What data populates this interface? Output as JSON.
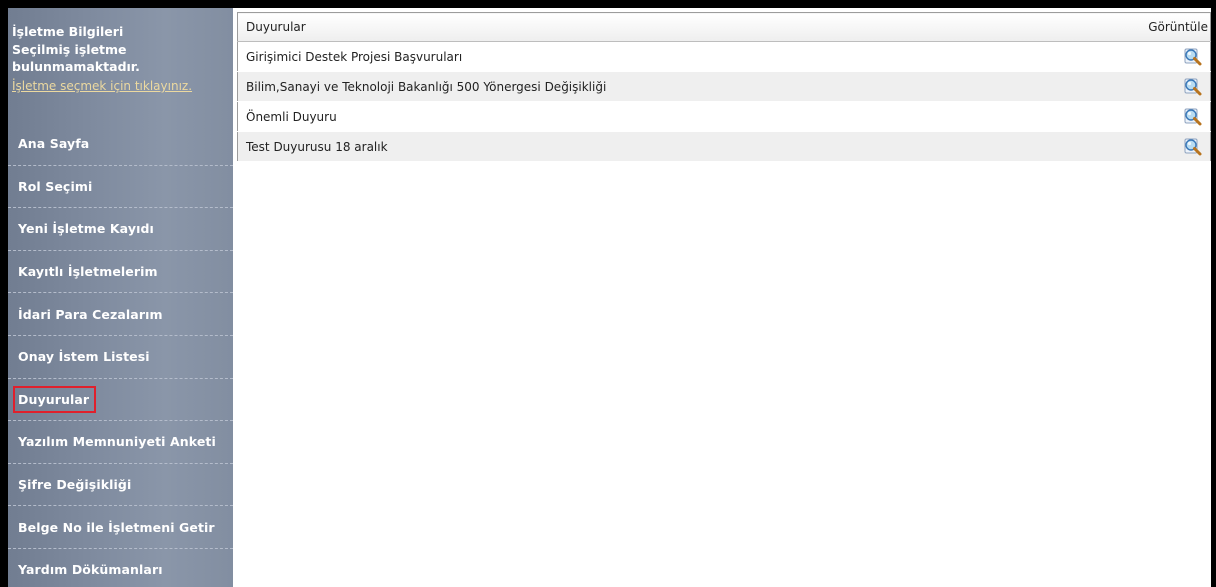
{
  "sidebar": {
    "info_title": "İşletme Bilgileri",
    "info_message": "Seçilmiş işletme bulunmamaktadır.",
    "info_link": "İşletme seçmek için tıklayınız.",
    "menu": [
      {
        "label": "Ana Sayfa"
      },
      {
        "label": "Rol Seçimi"
      },
      {
        "label": "Yeni İşletme Kayıdı"
      },
      {
        "label": "Kayıtlı İşletmelerim"
      },
      {
        "label": "İdari Para Cezalarım"
      },
      {
        "label": "Onay İstem Listesi"
      },
      {
        "label": "Duyurular"
      },
      {
        "label": "Yazılım Memnuniyeti Anketi"
      },
      {
        "label": "Şifre Değişikliği"
      },
      {
        "label": "Belge No ile İşletmeni Getir"
      },
      {
        "label": "Yardım Dökümanları"
      }
    ],
    "active_item": "Duyurular",
    "active_highlight_color": "#e0202c"
  },
  "announcements": {
    "header_title": "Duyurular",
    "header_view": "Görüntüle",
    "view_icon": "magnifier-icon",
    "rows": [
      {
        "title": "Girişimici Destek Projesi Başvuruları"
      },
      {
        "title": "Bilim,Sanayi ve Teknoloji Bakanlığı 500 Yönergesi Değişikliği"
      },
      {
        "title": "Önemli Duyuru"
      },
      {
        "title": "Test Duyurusu 18 aralık"
      }
    ]
  }
}
